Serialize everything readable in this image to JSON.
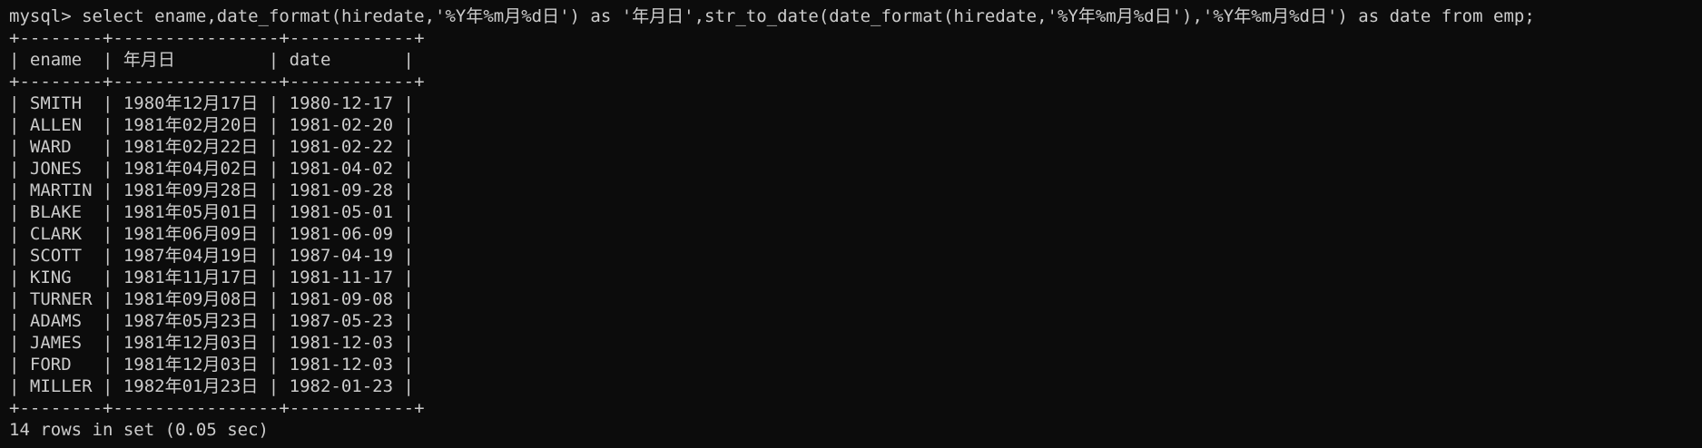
{
  "terminal": {
    "prompt": "mysql> ",
    "command": "select ename,date_format(hiredate,'%Y年%m月%d日') as '年月日',str_to_date(date_format(hiredate,'%Y年%m月%d日'),'%Y年%m月%d日') as date from emp;",
    "border_top": "+--------+----------------+------------+",
    "header": "| ename  | 年月日         | date       |",
    "border_mid": "+--------+----------------+------------+",
    "rows": [
      "| SMITH  | 1980年12月17日 | 1980-12-17 |",
      "| ALLEN  | 1981年02月20日 | 1981-02-20 |",
      "| WARD   | 1981年02月22日 | 1981-02-22 |",
      "| JONES  | 1981年04月02日 | 1981-04-02 |",
      "| MARTIN | 1981年09月28日 | 1981-09-28 |",
      "| BLAKE  | 1981年05月01日 | 1981-05-01 |",
      "| CLARK  | 1981年06月09日 | 1981-06-09 |",
      "| SCOTT  | 1987年04月19日 | 1987-04-19 |",
      "| KING   | 1981年11月17日 | 1981-11-17 |",
      "| TURNER | 1981年09月08日 | 1981-09-08 |",
      "| ADAMS  | 1987年05月23日 | 1987-05-23 |",
      "| JAMES  | 1981年12月03日 | 1981-12-03 |",
      "| FORD   | 1981年12月03日 | 1981-12-03 |",
      "| MILLER | 1982年01月23日 | 1982-01-23 |"
    ],
    "border_bottom": "+--------+----------------+------------+",
    "footer": "14 rows in set (0.05 sec)"
  },
  "colors": {
    "background": "#0c0c0c",
    "text": "#cccccc"
  }
}
